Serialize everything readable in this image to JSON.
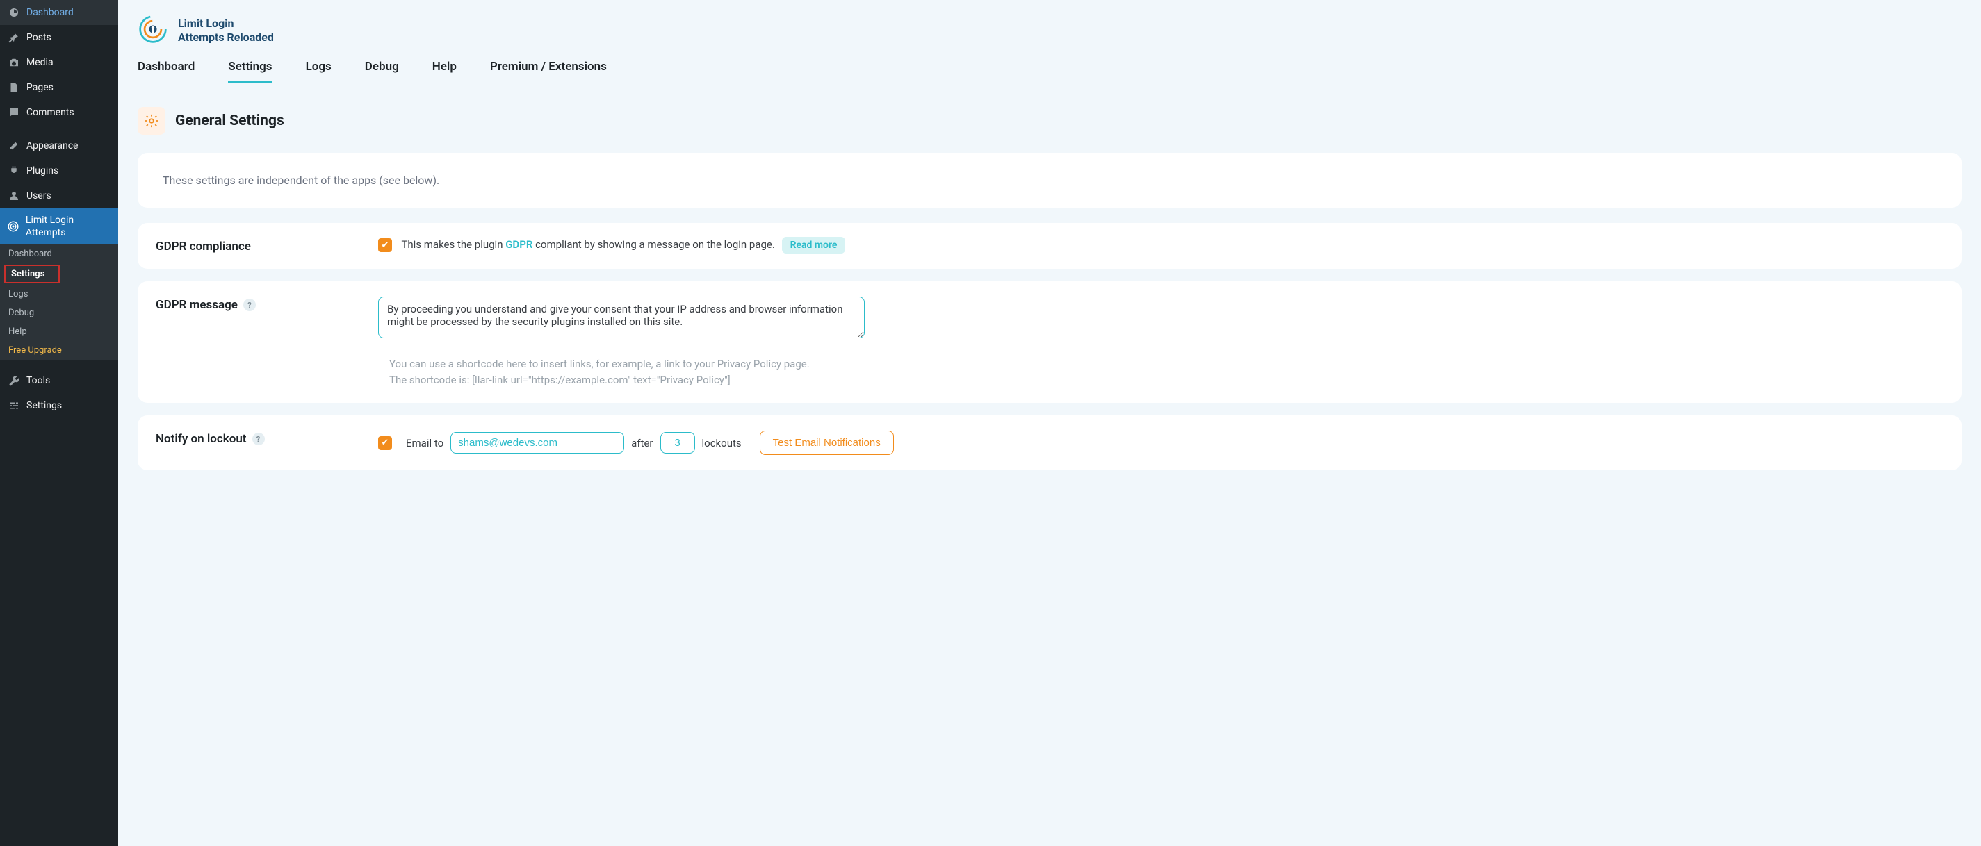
{
  "sidebar": {
    "items": [
      {
        "label": "Dashboard",
        "icon": "gauge"
      },
      {
        "label": "Posts",
        "icon": "pin"
      },
      {
        "label": "Media",
        "icon": "camera"
      },
      {
        "label": "Pages",
        "icon": "page"
      },
      {
        "label": "Comments",
        "icon": "comment"
      },
      {
        "label": "Appearance",
        "icon": "brush"
      },
      {
        "label": "Plugins",
        "icon": "plug"
      },
      {
        "label": "Users",
        "icon": "user"
      },
      {
        "label": "Limit Login Attempts",
        "icon": "target",
        "active": true
      },
      {
        "label": "Tools",
        "icon": "wrench"
      },
      {
        "label": "Settings",
        "icon": "sliders"
      }
    ],
    "submenu": [
      {
        "label": "Dashboard"
      },
      {
        "label": "Settings",
        "current": true,
        "highlight": true
      },
      {
        "label": "Logs"
      },
      {
        "label": "Debug"
      },
      {
        "label": "Help"
      },
      {
        "label": "Free Upgrade",
        "upgrade": true
      }
    ]
  },
  "brand": {
    "line1": "Limit Login",
    "line2": "Attempts Reloaded"
  },
  "tabs": [
    "Dashboard",
    "Settings",
    "Logs",
    "Debug",
    "Help",
    "Premium / Extensions"
  ],
  "active_tab": "Settings",
  "section": {
    "title": "General Settings"
  },
  "info": "These settings are independent of the apps (see below).",
  "gdpr_compliance": {
    "label": "GDPR compliance",
    "checked": true,
    "text_before": "This makes the plugin ",
    "link": "GDPR",
    "text_after": " compliant by showing a message on the login page.",
    "readmore": "Read more"
  },
  "gdpr_message": {
    "label": "GDPR message",
    "value": "By proceeding you understand and give your consent that your IP address and browser information might be processed by the security plugins installed on this site.",
    "hint1": "You can use a shortcode here to insert links, for example, a link to your Privacy Policy page.",
    "hint2": "The shortcode is: [llar-link url=\"https://example.com\" text=\"Privacy Policy\"]"
  },
  "notify": {
    "label": "Notify on lockout",
    "checked": true,
    "email_to_label": "Email to",
    "email": "shams@wedevs.com",
    "after_label": "after",
    "count": "3",
    "lockouts_label": "lockouts",
    "test_button": "Test Email Notifications"
  }
}
